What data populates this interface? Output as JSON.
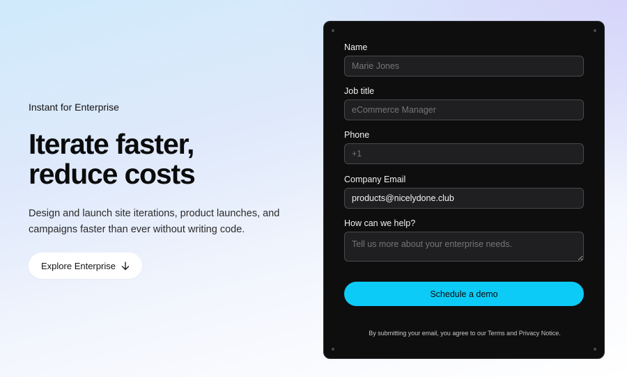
{
  "hero": {
    "eyebrow": "Instant for Enterprise",
    "headline_line1": "Iterate faster,",
    "headline_line2": "reduce costs",
    "description": "Design and launch site iterations, product launches, and campaigns faster than ever without writing code.",
    "cta_label": "Explore Enterprise",
    "cta_icon": "arrow-down-icon"
  },
  "form": {
    "name": {
      "label": "Name",
      "placeholder": "Marie Jones",
      "value": ""
    },
    "job_title": {
      "label": "Job title",
      "placeholder": "eCommerce Manager",
      "value": ""
    },
    "phone": {
      "label": "Phone",
      "placeholder": "+1",
      "value": ""
    },
    "email": {
      "label": "Company Email",
      "placeholder": "",
      "value": "products@nicelydone.club"
    },
    "help": {
      "label": "How can we help?",
      "placeholder": "Tell us more about your enterprise needs.",
      "value": ""
    },
    "submit_label": "Schedule a demo",
    "legal": "By submitting your email, you agree to our Terms and Privacy Notice."
  },
  "colors": {
    "accent": "#0dcbf7",
    "card_background": "#0e0e0f",
    "field_background": "#1f1f21"
  }
}
